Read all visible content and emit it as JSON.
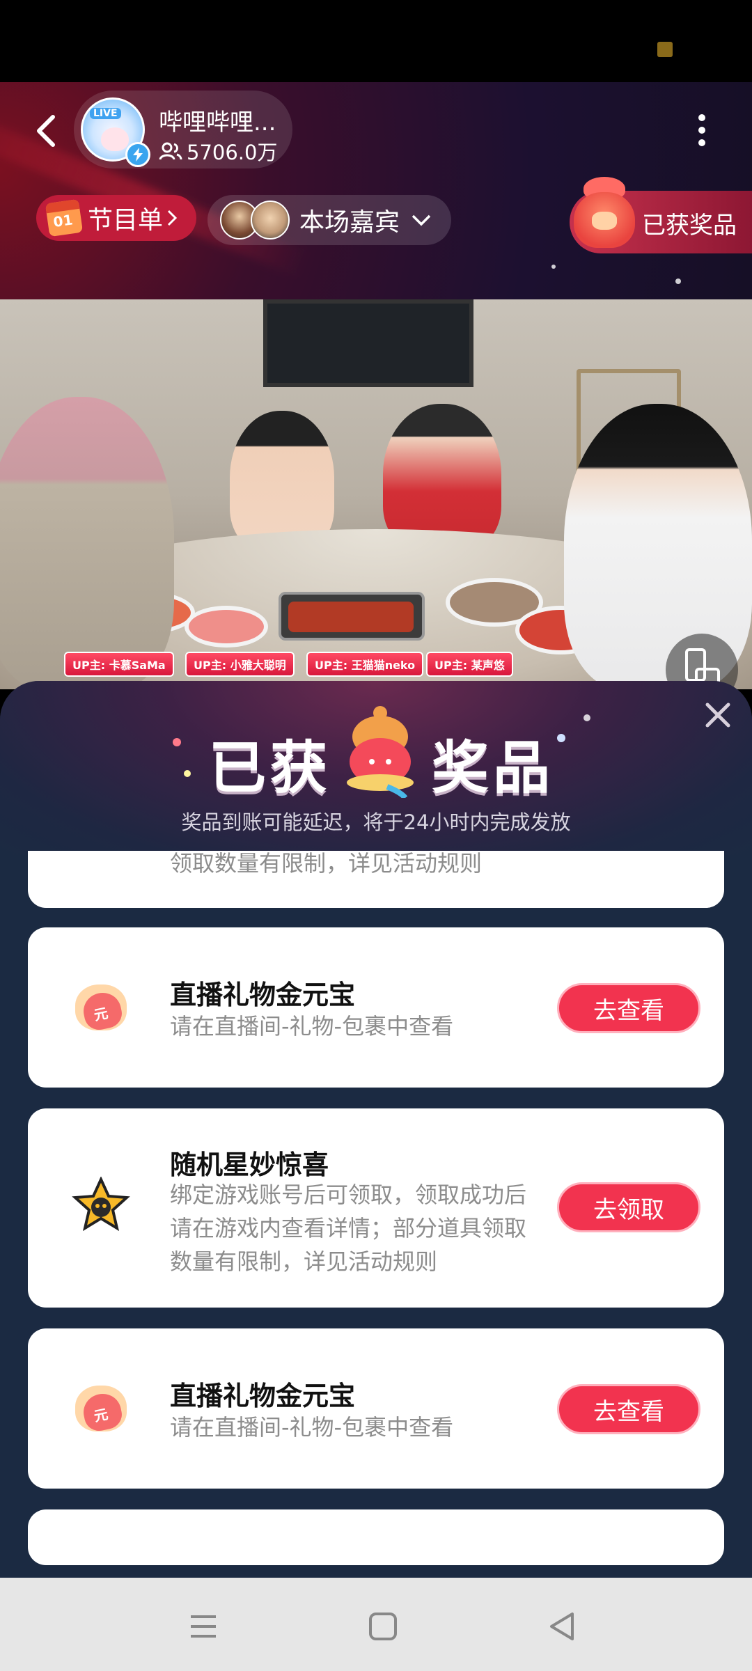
{
  "header": {
    "host_name": "哔哩哔哩...",
    "followers": "5706.0万",
    "live_tag": "LIVE",
    "program_label": "节目单",
    "program_icon_text": "01",
    "guests_label": "本场嘉宾",
    "prizes_label": "已获奖品"
  },
  "video": {
    "name_tags": [
      "UP主: 卡慕SaMa",
      "UP主: 小雅大聪明",
      "UP主: 王猫猫neko",
      "UP主: 某声悠"
    ]
  },
  "panel": {
    "title_left": "已获",
    "title_right": "奖品",
    "subtitle": "奖品到账可能延迟，将于24小时内完成发放",
    "cards": [
      {
        "title": "",
        "desc": "领取数量有限制，详见活动规则",
        "action": ""
      },
      {
        "title": "直播礼物金元宝",
        "desc": "请在直播间-礼物-包裹中查看",
        "action": "去查看"
      },
      {
        "title": "随机星妙惊喜",
        "desc": "绑定游戏账号后可领取，领取成功后请在游戏内查看详情；部分道具领取数量有限制，详见活动规则",
        "action": "去领取"
      },
      {
        "title": "直播礼物金元宝",
        "desc": "请在直播间-礼物-包裹中查看",
        "action": "去查看"
      }
    ],
    "ingot_text": "元"
  },
  "icons": [
    "back-arrow-icon",
    "followers-icon",
    "more-icon",
    "calendar-icon",
    "chevron-right-icon",
    "chevron-down-icon",
    "gift-bag-icon",
    "rotate-screen-icon",
    "close-icon",
    "gold-ingot-icon",
    "star-badge-icon",
    "menu-icon",
    "home-icon",
    "back-triangle-icon"
  ],
  "colors": {
    "accent": "#f2334f",
    "panel_bg": "#1b2a42",
    "header_bg": "#1c1030"
  }
}
